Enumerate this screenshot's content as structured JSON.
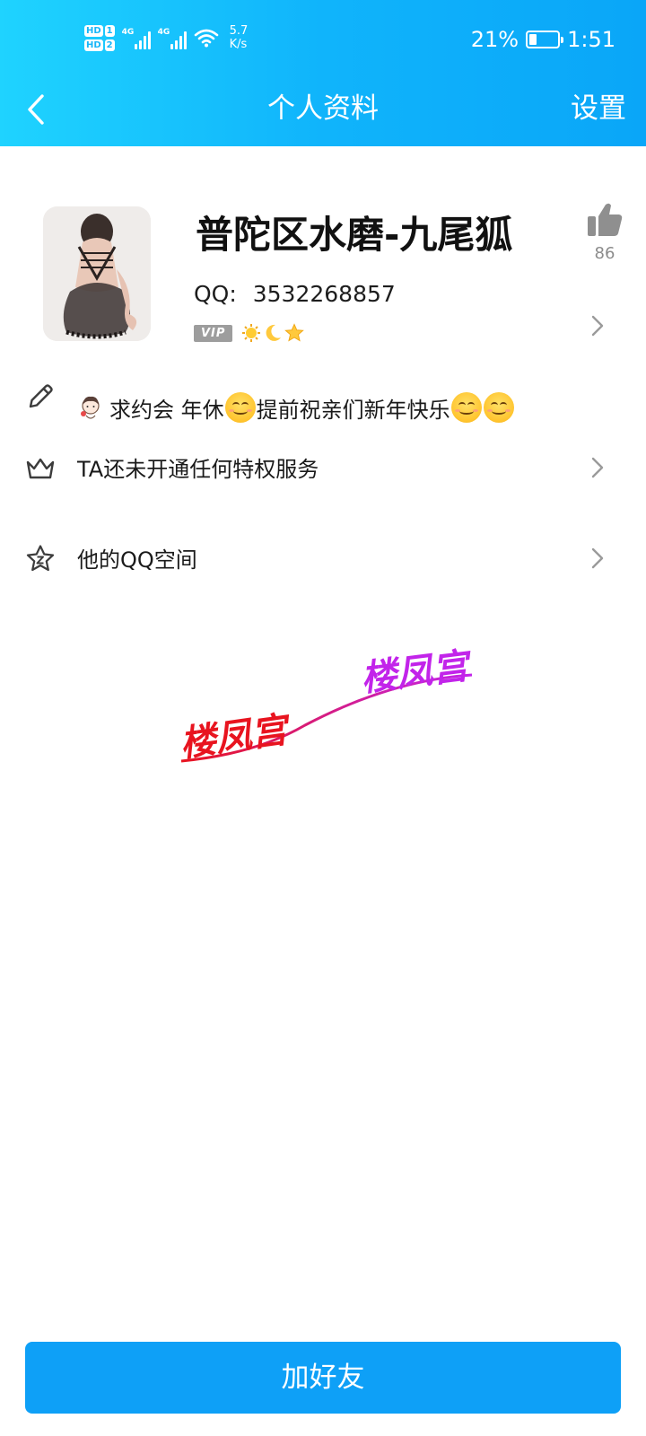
{
  "status_bar": {
    "hd1": "HD",
    "sim1": "1",
    "hd2": "HD",
    "sim2": "2",
    "net1": "4G",
    "net2": "4G",
    "speed_value": "5.7",
    "speed_unit": "K/s",
    "battery_percent": "21%",
    "battery_level": 0.21,
    "time": "1:51"
  },
  "nav": {
    "title": "个人资料",
    "settings_label": "设置"
  },
  "profile": {
    "nickname": "普陀区水磨-九尾狐",
    "qq_label": "QQ:",
    "qq_number": "3532268857",
    "vip_badge": "VIP",
    "like_count": "86"
  },
  "rows": {
    "signature_text_1": "求约会 年休",
    "signature_text_2": "提前祝亲们新年快乐",
    "privilege_text": "TA还未开通任何特权服务",
    "qzone_text": "他的QQ空间"
  },
  "watermark": {
    "text_1": "楼凤宫",
    "text_2": "楼凤宫"
  },
  "add_friend_label": "加好友",
  "colors": {
    "header_start": "#1fd3ff",
    "header_end": "#0aa6f8",
    "primary_button": "#0ea0f7",
    "watermark_red": "#e8141f",
    "watermark_purple": "#c224ea"
  },
  "icons": [
    "back-icon",
    "thumbs-up-icon",
    "chevron-right-icon",
    "pencil-icon",
    "crown-icon",
    "star-icon",
    "battery-icon",
    "wifi-icon",
    "signal-icon"
  ]
}
